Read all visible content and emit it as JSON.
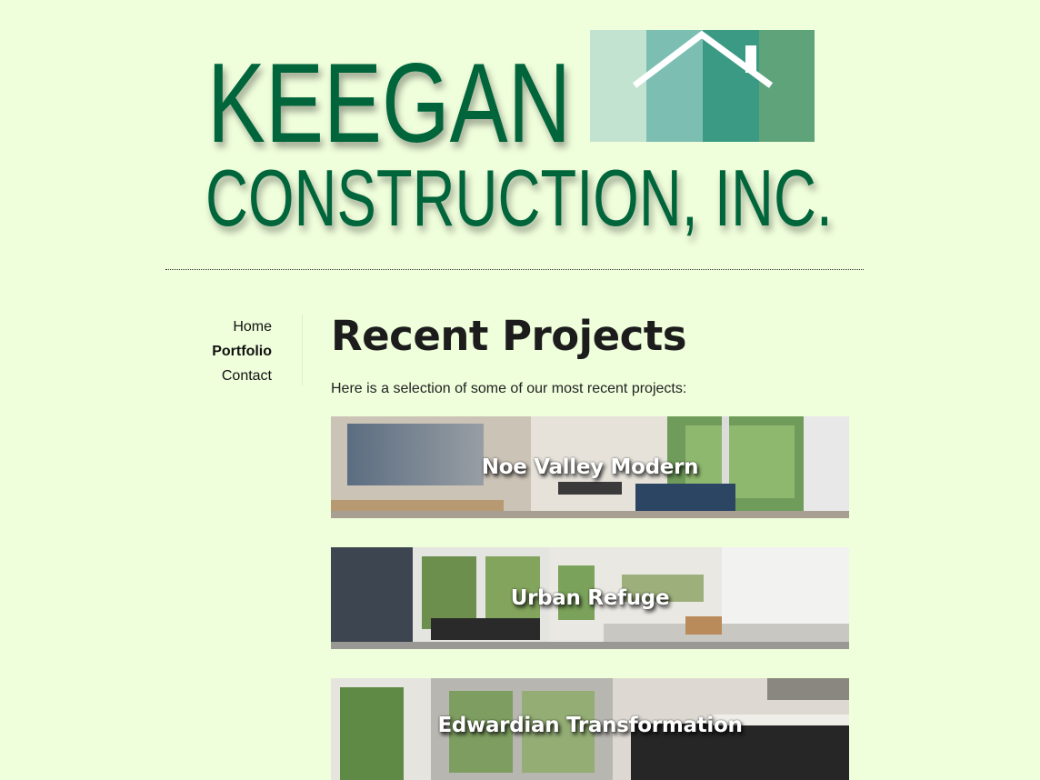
{
  "logo": {
    "line1": "KEEGAN",
    "line2": "CONSTRUCTION, INC."
  },
  "colors": {
    "background": "#effedb",
    "brand_green": "#00653a",
    "logo_tiles": [
      "#c2e3cf",
      "#7cbfb2",
      "#3b9a84",
      "#5fa37a"
    ]
  },
  "nav": {
    "items": [
      {
        "label": "Home"
      },
      {
        "label": "Portfolio"
      },
      {
        "label": "Contact"
      }
    ],
    "active": "Portfolio"
  },
  "main": {
    "title": "Recent Projects",
    "intro": "Here is a selection of some of our most recent projects:",
    "projects": [
      {
        "title": "Noe Valley Modern"
      },
      {
        "title": "Urban Refuge"
      },
      {
        "title": "Edwardian Transformation"
      }
    ]
  }
}
